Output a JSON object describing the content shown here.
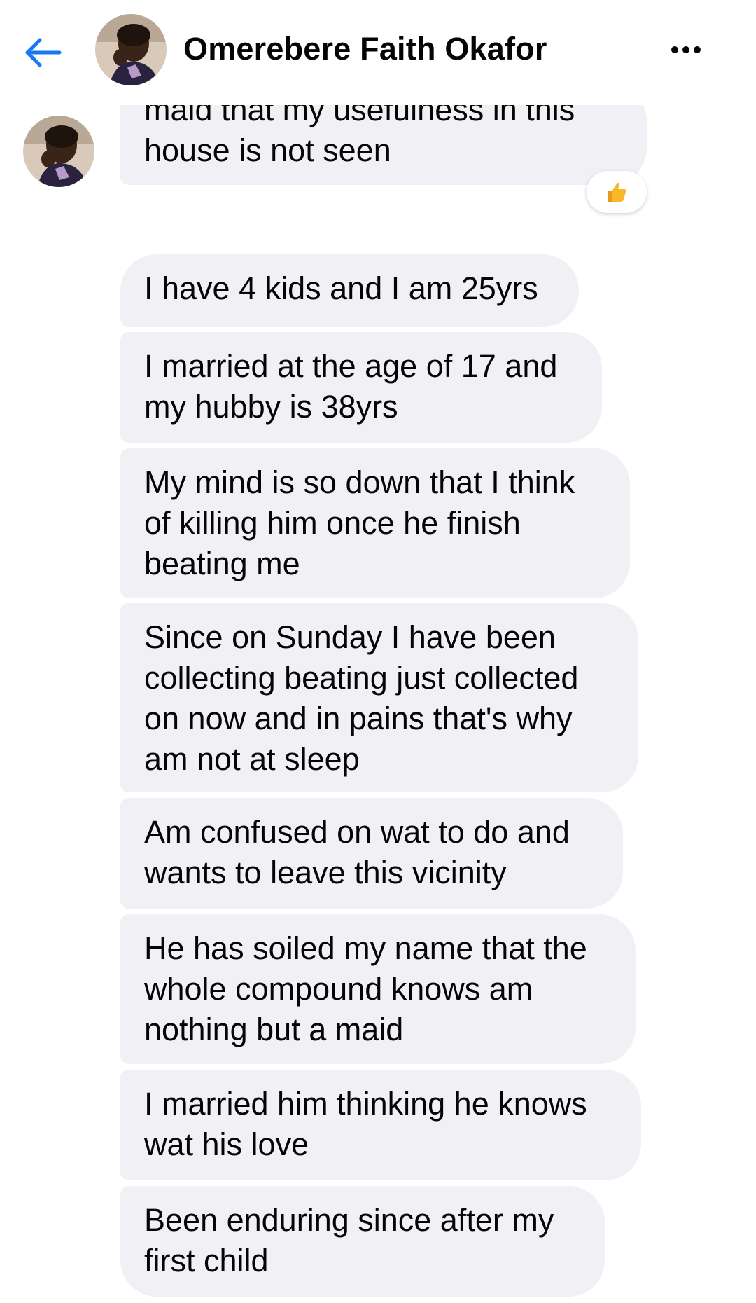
{
  "header": {
    "contact_name": "Omerebere Faith Okafor",
    "back_icon": "arrow-left-icon",
    "more_icon": "more-dots-icon"
  },
  "colors": {
    "accent": "#1877f2",
    "bubble_bg": "#f0f0f5",
    "text": "#050505",
    "reaction": "#f7b928"
  },
  "messages": [
    {
      "lines": [
        "maid that my usefulness in this",
        "house is not seen"
      ],
      "reaction": "thumbs-up-icon"
    },
    {
      "lines": [
        "I have 4 kids and I am 25yrs"
      ]
    },
    {
      "lines": [
        "I married at the age of 17 and",
        "my hubby is 38yrs"
      ]
    },
    {
      "lines": [
        "My mind is so down that I think",
        "of killing him once he finish",
        "beating me"
      ]
    },
    {
      "lines": [
        "Since on Sunday I have been",
        "collecting beating just collected",
        "on now and in pains that's why",
        "am not at sleep"
      ]
    },
    {
      "lines": [
        "Am confused on wat to do and",
        "wants to leave this vicinity"
      ]
    },
    {
      "lines": [
        "He has soiled my name that the",
        "whole compound knows am",
        "nothing but a maid"
      ]
    },
    {
      "lines": [
        "I married him thinking he knows",
        "wat his love"
      ]
    },
    {
      "lines": [
        "Been enduring since after my",
        "first child"
      ]
    }
  ]
}
